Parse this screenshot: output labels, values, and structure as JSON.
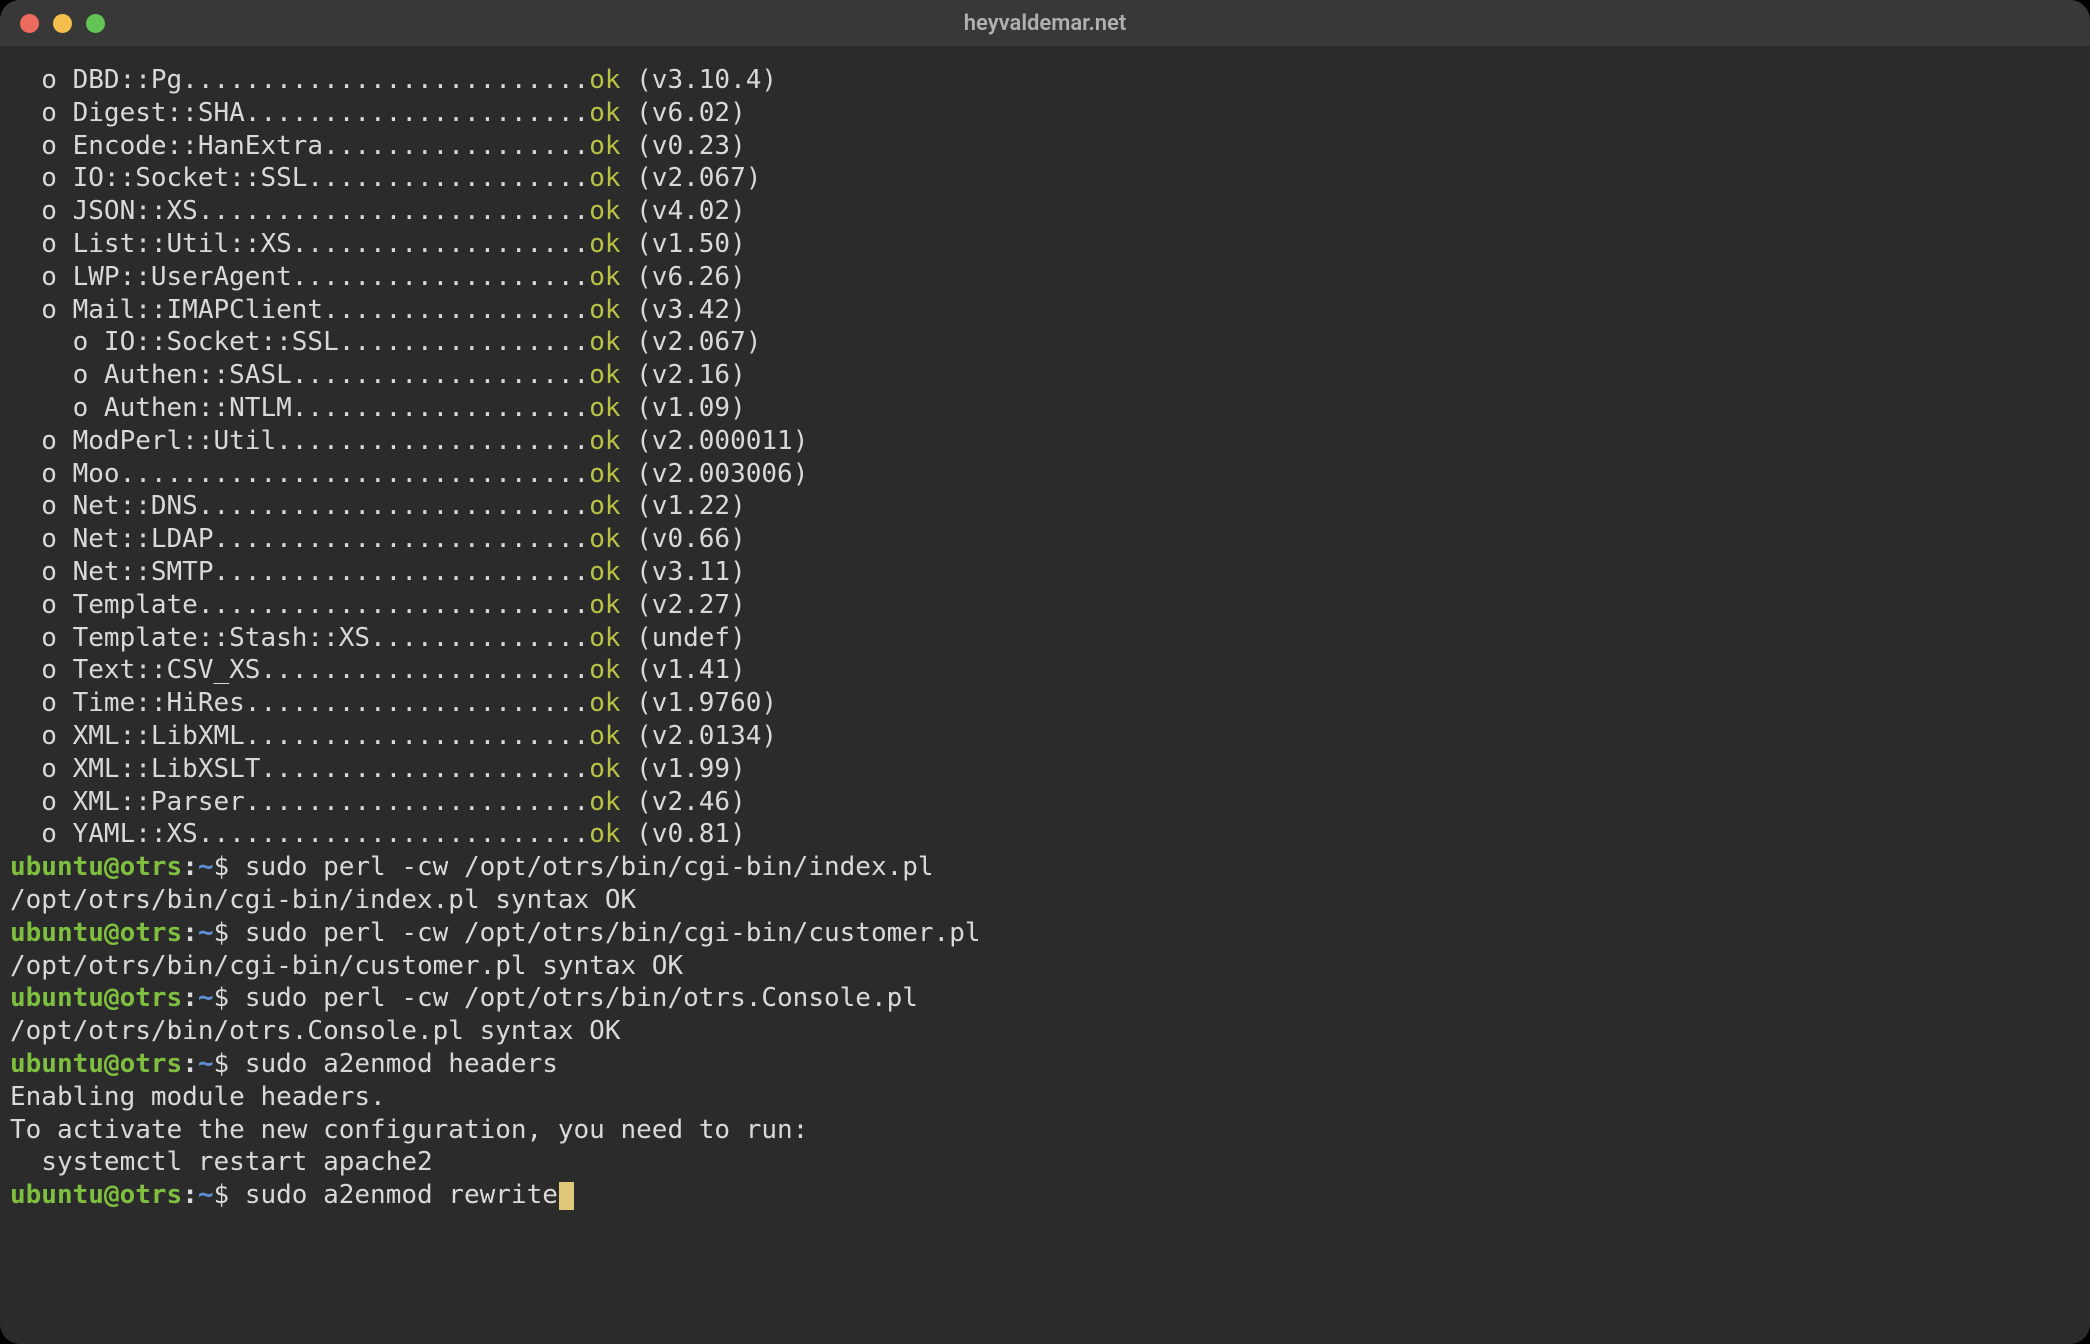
{
  "window": {
    "title": "heyvaldemar.net"
  },
  "colors": {
    "ok": "#b9c244",
    "prompt_user": "#7fbf3f",
    "prompt_path": "#5f8fd6",
    "cursor": "#e0c97a",
    "bg": "#2b2b2b"
  },
  "prompt": {
    "user_host": "ubuntu@otrs",
    "separator": ":",
    "path": "~",
    "symbol": "$"
  },
  "modules": [
    {
      "indent": 1,
      "name": "DBD::Pg",
      "dots": "..........................",
      "ok": "ok",
      "ver": "(v3.10.4)"
    },
    {
      "indent": 1,
      "name": "Digest::SHA",
      "dots": "......................",
      "ok": "ok",
      "ver": "(v6.02)"
    },
    {
      "indent": 1,
      "name": "Encode::HanExtra",
      "dots": ".................",
      "ok": "ok",
      "ver": "(v0.23)"
    },
    {
      "indent": 1,
      "name": "IO::Socket::SSL",
      "dots": "..................",
      "ok": "ok",
      "ver": "(v2.067)"
    },
    {
      "indent": 1,
      "name": "JSON::XS",
      "dots": ".........................",
      "ok": "ok",
      "ver": "(v4.02)"
    },
    {
      "indent": 1,
      "name": "List::Util::XS",
      "dots": "...................",
      "ok": "ok",
      "ver": "(v1.50)"
    },
    {
      "indent": 1,
      "name": "LWP::UserAgent",
      "dots": "...................",
      "ok": "ok",
      "ver": "(v6.26)"
    },
    {
      "indent": 1,
      "name": "Mail::IMAPClient",
      "dots": ".................",
      "ok": "ok",
      "ver": "(v3.42)"
    },
    {
      "indent": 2,
      "name": "IO::Socket::SSL",
      "dots": "................",
      "ok": "ok",
      "ver": "(v2.067)"
    },
    {
      "indent": 2,
      "name": "Authen::SASL",
      "dots": "...................",
      "ok": "ok",
      "ver": "(v2.16)"
    },
    {
      "indent": 2,
      "name": "Authen::NTLM",
      "dots": "...................",
      "ok": "ok",
      "ver": "(v1.09)"
    },
    {
      "indent": 1,
      "name": "ModPerl::Util",
      "dots": "....................",
      "ok": "ok",
      "ver": "(v2.000011)"
    },
    {
      "indent": 1,
      "name": "Moo",
      "dots": "..............................",
      "ok": "ok",
      "ver": "(v2.003006)"
    },
    {
      "indent": 1,
      "name": "Net::DNS",
      "dots": ".........................",
      "ok": "ok",
      "ver": "(v1.22)"
    },
    {
      "indent": 1,
      "name": "Net::LDAP",
      "dots": "........................",
      "ok": "ok",
      "ver": "(v0.66)"
    },
    {
      "indent": 1,
      "name": "Net::SMTP",
      "dots": "........................",
      "ok": "ok",
      "ver": "(v3.11)"
    },
    {
      "indent": 1,
      "name": "Template",
      "dots": ".........................",
      "ok": "ok",
      "ver": "(v2.27)"
    },
    {
      "indent": 1,
      "name": "Template::Stash::XS",
      "dots": "..............",
      "ok": "ok",
      "ver": "(undef)"
    },
    {
      "indent": 1,
      "name": "Text::CSV_XS",
      "dots": ".....................",
      "ok": "ok",
      "ver": "(v1.41)"
    },
    {
      "indent": 1,
      "name": "Time::HiRes",
      "dots": "......................",
      "ok": "ok",
      "ver": "(v1.9760)"
    },
    {
      "indent": 1,
      "name": "XML::LibXML",
      "dots": "......................",
      "ok": "ok",
      "ver": "(v2.0134)"
    },
    {
      "indent": 1,
      "name": "XML::LibXSLT",
      "dots": ".....................",
      "ok": "ok",
      "ver": "(v1.99)"
    },
    {
      "indent": 1,
      "name": "XML::Parser",
      "dots": "......................",
      "ok": "ok",
      "ver": "(v2.46)"
    },
    {
      "indent": 1,
      "name": "YAML::XS",
      "dots": ".........................",
      "ok": "ok",
      "ver": "(v0.81)"
    }
  ],
  "commands": [
    {
      "cmd": "sudo perl -cw /opt/otrs/bin/cgi-bin/index.pl",
      "output": [
        "/opt/otrs/bin/cgi-bin/index.pl syntax OK"
      ]
    },
    {
      "cmd": "sudo perl -cw /opt/otrs/bin/cgi-bin/customer.pl",
      "output": [
        "/opt/otrs/bin/cgi-bin/customer.pl syntax OK"
      ]
    },
    {
      "cmd": "sudo perl -cw /opt/otrs/bin/otrs.Console.pl",
      "output": [
        "/opt/otrs/bin/otrs.Console.pl syntax OK"
      ]
    },
    {
      "cmd": "sudo a2enmod headers",
      "output": [
        "Enabling module headers.",
        "To activate the new configuration, you need to run:",
        "  systemctl restart apache2"
      ]
    }
  ],
  "current_command": "sudo a2enmod rewrite"
}
